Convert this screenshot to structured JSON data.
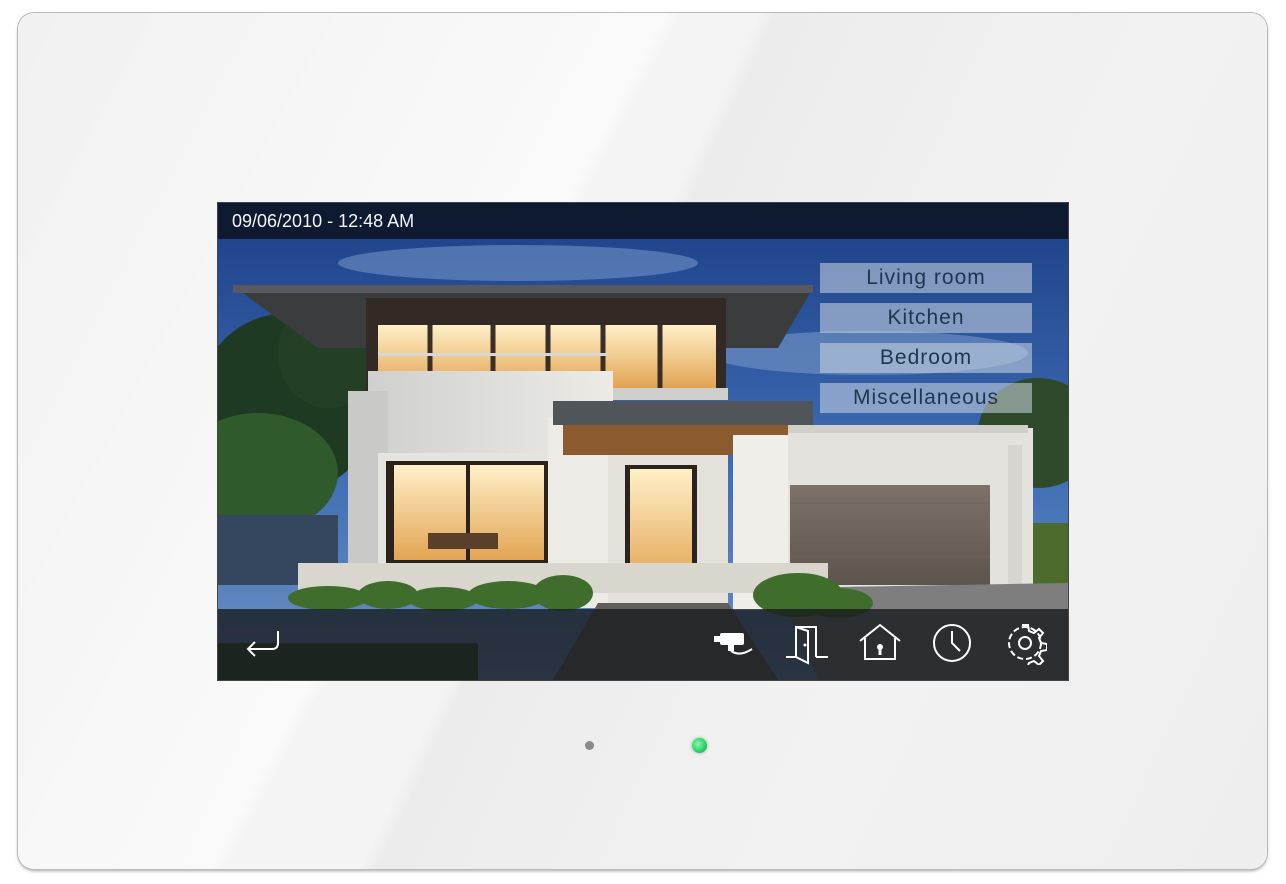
{
  "status_bar": {
    "datetime": "09/06/2010  -  12:48 AM"
  },
  "rooms": [
    {
      "label": "Living room"
    },
    {
      "label": "Kitchen"
    },
    {
      "label": "Bedroom"
    },
    {
      "label": "Miscellaneous"
    }
  ],
  "toolbar": {
    "icons": [
      "back-icon",
      "camera-icon",
      "door-icon",
      "home-lock-icon",
      "clock-icon",
      "gear-icon"
    ]
  },
  "indicators": {
    "status_led_color": "#2fd36a",
    "sensor_dot_color": "#8a8a8a"
  },
  "colors": {
    "room_button_text": "#1f3650",
    "top_bar": "#0c1424",
    "bezel": "#f1f1f1"
  }
}
